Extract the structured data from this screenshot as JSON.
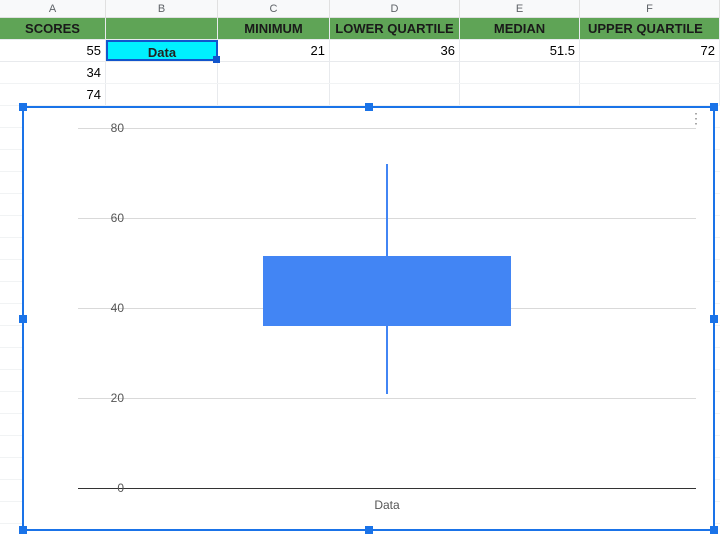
{
  "columns": {
    "a": "A",
    "b": "B",
    "c": "C",
    "d": "D",
    "e": "E",
    "f": "F"
  },
  "headers": {
    "scores": "SCORES",
    "minimum": "MINIMUM",
    "lower_q": "LOWER QUARTILE",
    "median": "MEDIAN",
    "upper_q": "UPPER QUARTILE"
  },
  "scores": {
    "r1": "55",
    "r2": "34",
    "r3": "74"
  },
  "stats": {
    "minimum": "21",
    "lower_q": "36",
    "median": "51.5",
    "upper_q": "72"
  },
  "selected_cell": "Data",
  "chart_menu_icon": "⋮",
  "chart_data": {
    "type": "boxplot",
    "categories": [
      "Data"
    ],
    "min": 21,
    "q1": 36,
    "median": 51.5,
    "q3": 51.5,
    "max": 72,
    "ylim": [
      0,
      80
    ],
    "yticks": [
      0,
      20,
      40,
      60,
      80
    ],
    "ytick_labels": {
      "0": "0",
      "20": "20",
      "40": "40",
      "60": "60",
      "80": "80"
    },
    "xlabel": "Data",
    "box_color": "#4285f4"
  }
}
